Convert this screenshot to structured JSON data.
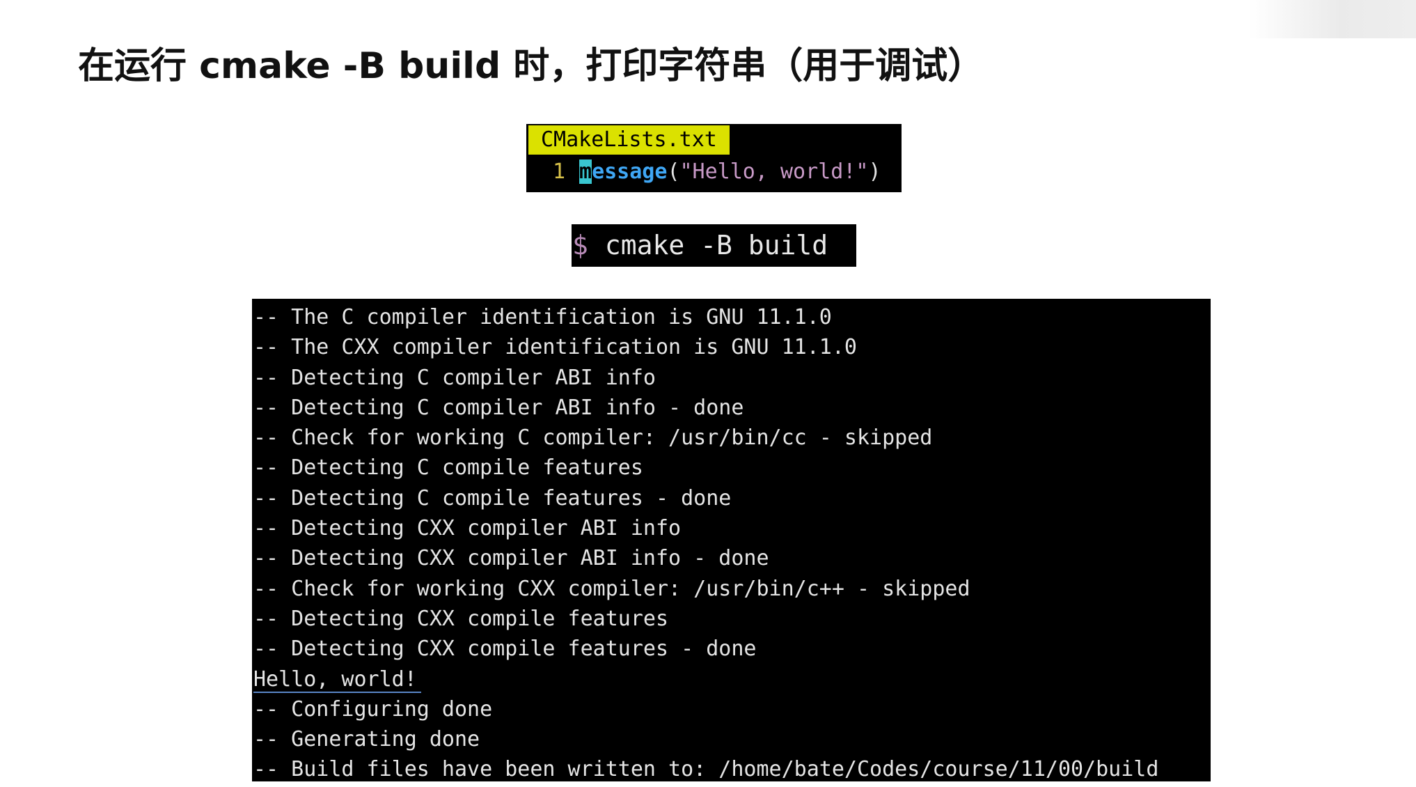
{
  "title": "在运行 cmake -B build 时，打印字符串（用于调试）",
  "editor": {
    "filename": "CMakeLists.txt",
    "line_number": "1",
    "cursor_char": "m",
    "keyword_rest": "essage",
    "open_paren": "(",
    "string": "\"Hello, world!\"",
    "close_paren": ")"
  },
  "command": {
    "prompt": "$",
    "text": "cmake -B build"
  },
  "terminal": {
    "lines": [
      "-- The C compiler identification is GNU 11.1.0",
      "-- The CXX compiler identification is GNU 11.1.0",
      "-- Detecting C compiler ABI info",
      "-- Detecting C compiler ABI info - done",
      "-- Check for working C compiler: /usr/bin/cc - skipped",
      "-- Detecting C compile features",
      "-- Detecting C compile features - done",
      "-- Detecting CXX compiler ABI info",
      "-- Detecting CXX compiler ABI info - done",
      "-- Check for working CXX compiler: /usr/bin/c++ - skipped",
      "-- Detecting CXX compile features",
      "-- Detecting CXX compile features - done",
      "Hello, world!",
      "-- Configuring done",
      "-- Generating done",
      "-- Build files have been written to: /home/bate/Codes/course/11/00/build"
    ]
  }
}
